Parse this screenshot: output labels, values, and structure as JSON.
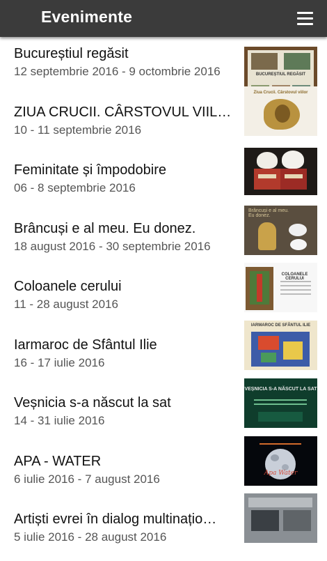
{
  "app": {
    "title": "Evenimente"
  },
  "events": [
    {
      "title": "Bucureștiul regăsit",
      "dates": "12 septembrie 2016 - 9 octombrie 2016",
      "thumb_icon": "bucurestiul-regasit-poster",
      "thumb_text": "BUCUREȘTIUL REGĂSIT"
    },
    {
      "title": "ZIUA CRUCII. CÂRSTOVUL VIILOR",
      "dates": "10 - 11 septembrie 2016",
      "thumb_icon": "grapes-poster",
      "thumb_text": "Ziua Crucii. Cârstovul viilor"
    },
    {
      "title": "Feminitate și împodobire",
      "dates": "06 - 8 septembrie 2016",
      "thumb_icon": "women-folk-costume-photo",
      "thumb_text": ""
    },
    {
      "title": "Brâncuși e al meu. Eu donez.",
      "dates": "18 august 2016 - 30 septembrie 2016",
      "thumb_icon": "brancusi-donation-poster",
      "thumb_text": "Brâncuși e al meu. Eu donez."
    },
    {
      "title": "Coloanele cerului",
      "dates": "11 - 28 august 2016",
      "thumb_icon": "coloanele-cerului-poster",
      "thumb_text": "COLOANELE CERULUI"
    },
    {
      "title": "Iarmaroc de Sfântul Ilie",
      "dates": "16 - 17 iulie 2016",
      "thumb_icon": "iarmaroc-poster",
      "thumb_text": "IARMAROC DE SFÂNTUL ILIE"
    },
    {
      "title": "Veșnicia s-a născut la sat",
      "dates": "14 - 31 iulie 2016",
      "thumb_icon": "vesnicia-poster",
      "thumb_text": "VEȘNICIA S-A NĂSCUT LA SAT"
    },
    {
      "title": "APA - WATER",
      "dates": "6 iulie 2016 - 7 august 2016",
      "thumb_icon": "apa-water-moon-poster",
      "thumb_text": "Apa Water"
    },
    {
      "title": "Artiști evrei în dialog multinațio…",
      "dates": "5 iulie 2016 - 28 august 2016",
      "thumb_icon": "artisti-evrei-poster",
      "thumb_text": ""
    }
  ]
}
